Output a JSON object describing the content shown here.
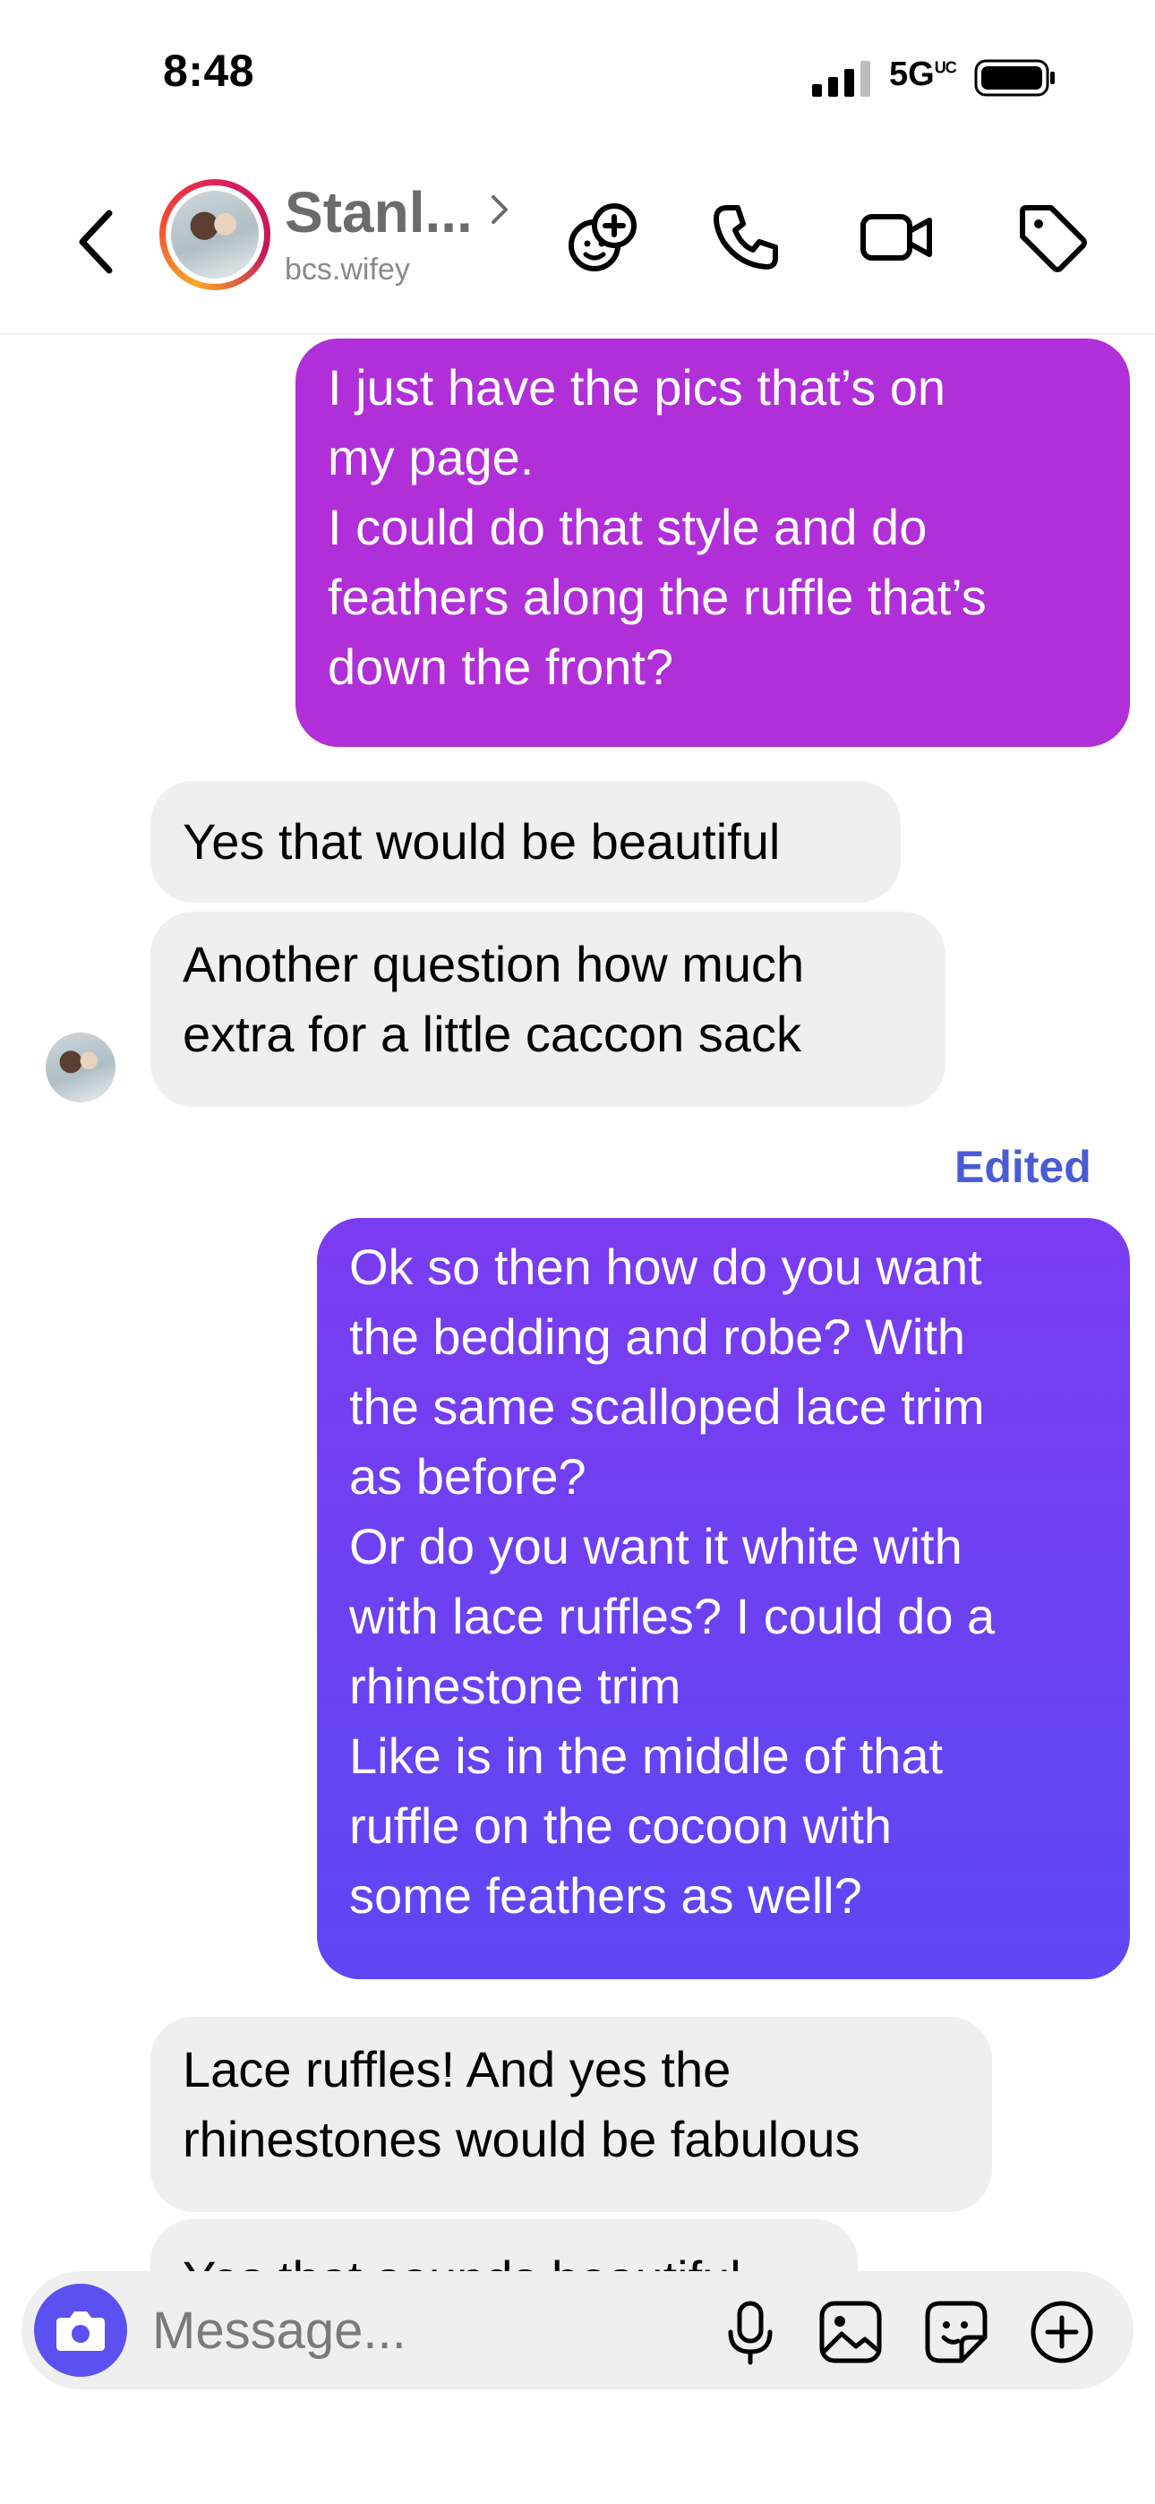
{
  "status_bar": {
    "time": "8:48",
    "network": "5G",
    "network_superscript": "UC"
  },
  "header": {
    "contact_name": "Stanl...",
    "contact_handle": "bcs.wifey",
    "icons": [
      "back-chevron-icon",
      "effects-icon",
      "phone-icon",
      "video-icon",
      "tag-icon"
    ]
  },
  "messages": [
    {
      "direction": "outgoing",
      "lines": [
        "I just have the pics that’s on",
        "my page.",
        "I could do that style and do",
        "feathers along the ruffle that’s",
        "down the front?"
      ]
    },
    {
      "direction": "incoming",
      "lines": [
        "Yes that would be beautiful"
      ]
    },
    {
      "direction": "incoming",
      "lines": [
        "Another question how much",
        "extra for a little caccon sack"
      ]
    },
    {
      "direction": "outgoing",
      "edited_label": "Edited",
      "lines": [
        "Ok so then how do you want",
        "the bedding and robe? With",
        "the same scalloped lace trim",
        "as before?",
        "Or do you want it white with",
        "with lace ruffles? I could do a",
        "rhinestone trim",
        "Like is in the middle of that",
        "ruffle on the cocoon with",
        "some feathers as well?"
      ]
    },
    {
      "direction": "incoming",
      "lines": [
        "Lace ruffles! And yes the",
        "rhinestones would be fabulous"
      ]
    },
    {
      "direction": "incoming",
      "lines": [
        "Yes that sounds beautiful"
      ]
    }
  ],
  "composer": {
    "placeholder": "Message...",
    "icons": [
      "camera-icon",
      "microphone-icon",
      "gallery-icon",
      "sticker-icon",
      "add-icon"
    ]
  },
  "colors": {
    "outgoing_top": "#b82fd6",
    "outgoing_bottom": "#5e46f4",
    "incoming_bg": "#efefef",
    "edited_label": "#4a5bd6",
    "camera_button": "#5b51f1"
  }
}
